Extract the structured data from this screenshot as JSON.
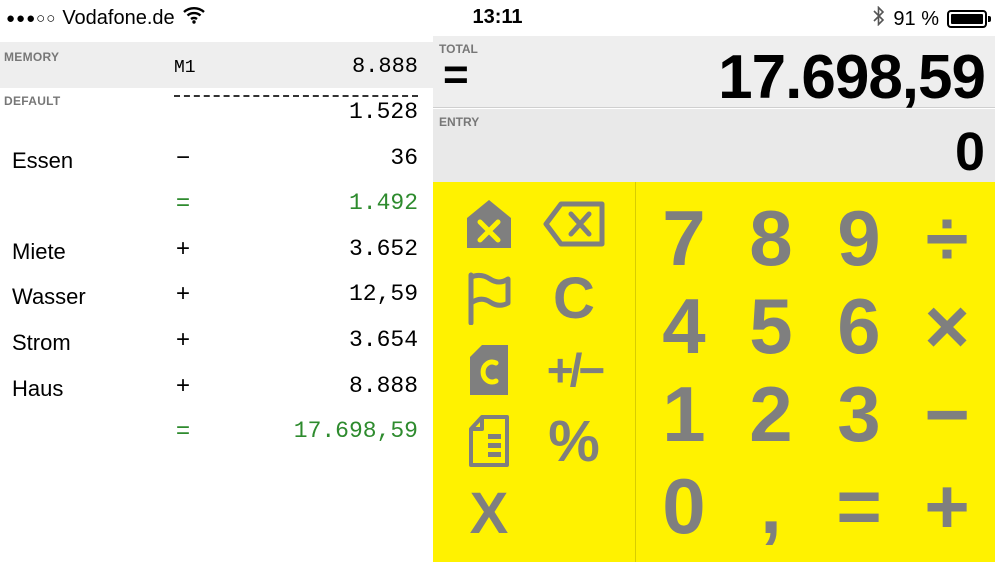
{
  "status_bar": {
    "carrier": "Vodafone.de",
    "signal_dots": "●●●○○",
    "time": "13:11",
    "battery_percent": "91 %"
  },
  "tape": {
    "memory_label": "MEMORY",
    "memory_name": "M1",
    "memory_value": "8.888",
    "default_label": "DEFAULT",
    "rows": [
      {
        "label": "",
        "op": "",
        "value": "1.528",
        "color": "#000000"
      },
      {
        "label": "Essen",
        "op": "−",
        "value": "36",
        "color": "#000000"
      },
      {
        "label": "",
        "op": "=",
        "value": "1.492",
        "color": "#2e8b2e"
      },
      {
        "label": "Miete",
        "op": "+",
        "value": "3.652",
        "color": "#000000"
      },
      {
        "label": "Wasser",
        "op": "+",
        "value": "12,59",
        "color": "#000000"
      },
      {
        "label": "Strom",
        "op": "+",
        "value": "3.654",
        "color": "#000000"
      },
      {
        "label": "Haus",
        "op": "+",
        "value": "8.888",
        "color": "#000000"
      },
      {
        "label": "",
        "op": "=",
        "value": "17.698,59",
        "color": "#2e8b2e"
      }
    ]
  },
  "display": {
    "total_label": "TOTAL",
    "total_sign": "=",
    "total_value": "17.698,59",
    "entry_label": "ENTRY",
    "entry_value": "0"
  },
  "keypad": {
    "accent_color": "#fff200",
    "key_color": "#7f7f7f",
    "function_keys": {
      "clear_memory_icon": "memory-clear-icon",
      "backspace_icon": "backspace-icon",
      "flag_icon": "flag-icon",
      "clear": "C",
      "copy_icon": "copy-icon",
      "plus_minus": "+/−",
      "paste_icon": "paste-icon",
      "percent": "%",
      "close": "X"
    },
    "digits": {
      "d7": "7",
      "d8": "8",
      "d9": "9",
      "d4": "4",
      "d5": "5",
      "d6": "6",
      "d1": "1",
      "d2": "2",
      "d3": "3",
      "d0": "0",
      "comma": ","
    },
    "operators": {
      "divide": "÷",
      "multiply": "×",
      "subtract": "−",
      "add": "+",
      "equals": "="
    }
  }
}
